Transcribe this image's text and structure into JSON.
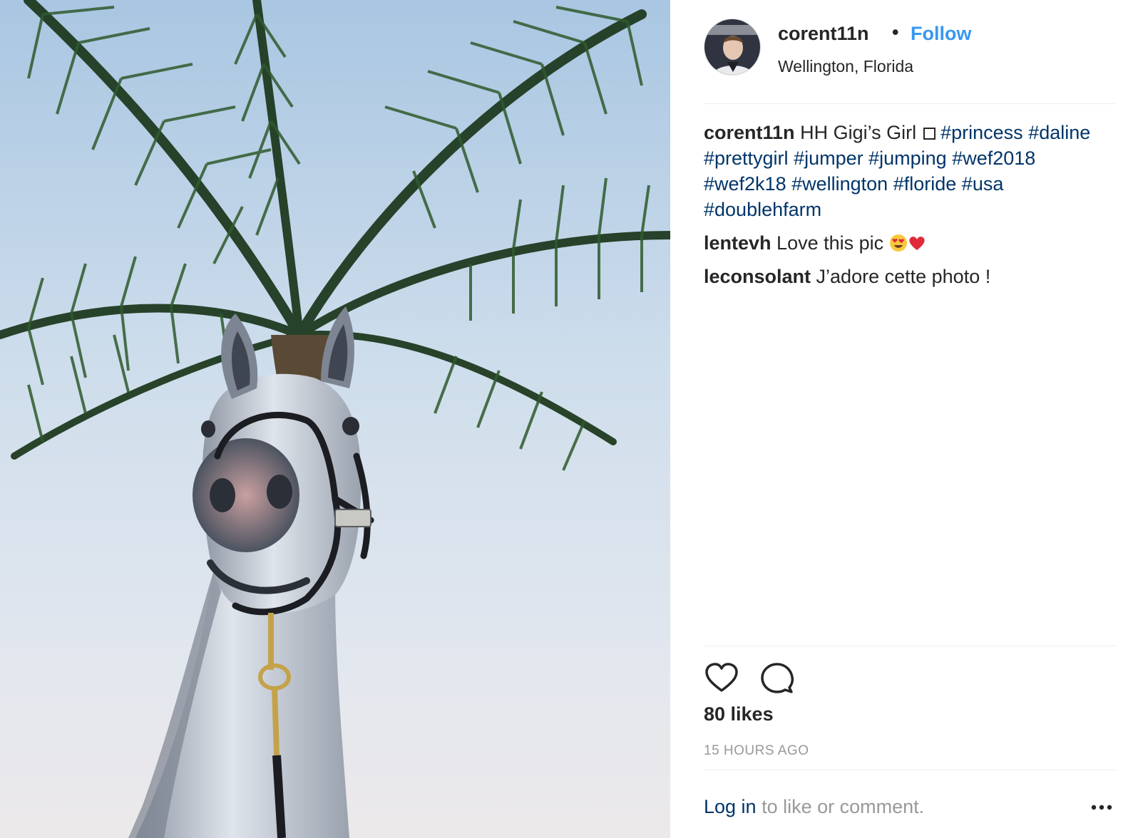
{
  "post": {
    "username": "corent11n",
    "separator": "•",
    "follow_label": "Follow",
    "location": "Wellington, Florida"
  },
  "comments": [
    {
      "user": "corent11n",
      "text": "HH Gigi’s Girl",
      "tags": [
        "#princess",
        "#daline",
        "#prettygirl",
        "#jumper",
        "#jumping",
        "#wef2018",
        "#wef2k18",
        "#wellington",
        "#floride",
        "#usa",
        "#doublehfarm"
      ]
    },
    {
      "user": "lentevh",
      "text": "Love this pic",
      "emoji": [
        "heart-eyes-emoji",
        "red-heart-emoji"
      ]
    },
    {
      "user": "leconsolant",
      "text": "J’adore cette photo !"
    }
  ],
  "actions": {
    "like_icon": "heart-outline-icon",
    "comment_icon": "speech-bubble-icon",
    "likes": "80 likes",
    "time": "15 HOURS AGO"
  },
  "login_bar": {
    "login_link": "Log in",
    "login_rest": " to like or comment.",
    "more_icon": "ellipsis-icon"
  },
  "colors": {
    "accent": "#3897f0",
    "hashtag": "#003569",
    "text": "#262626",
    "muted": "#999999",
    "divider": "#efefef"
  }
}
